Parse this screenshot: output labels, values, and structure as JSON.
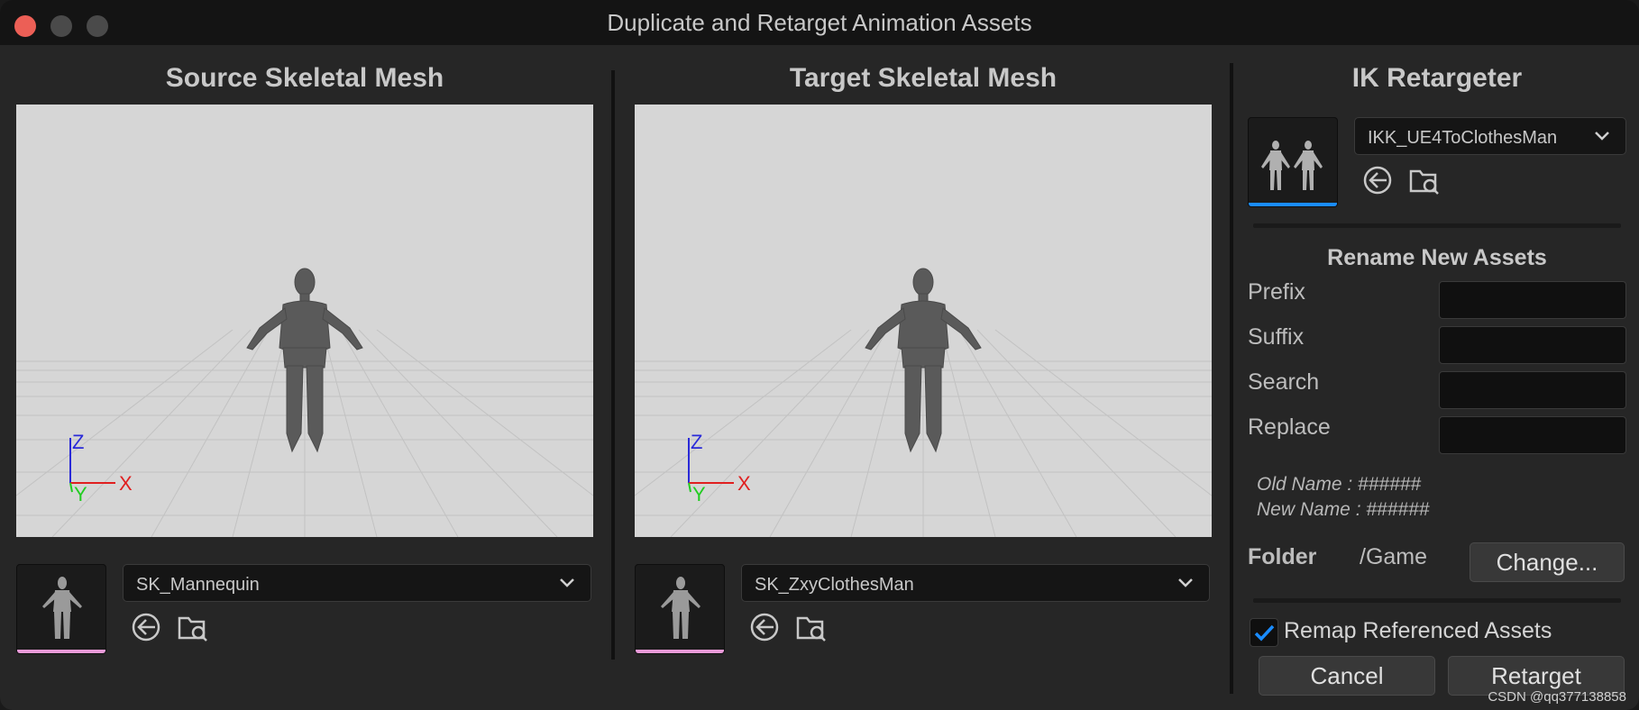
{
  "window": {
    "title": "Duplicate and Retarget Animation Assets"
  },
  "source": {
    "title": "Source Skeletal Mesh",
    "mesh": "SK_Mannequin",
    "bar_color": "#e89ad8"
  },
  "target": {
    "title": "Target Skeletal Mesh",
    "mesh": "SK_ZxyClothesMan",
    "bar_color": "#e89ad8"
  },
  "axes": {
    "z": "Z",
    "x": "X",
    "y": "Y",
    "z_color": "#2a2ad8",
    "x_color": "#e02020",
    "y_color": "#22cc22"
  },
  "retargeter": {
    "title": "IK Retargeter",
    "asset": "IKK_UE4ToClothesMan",
    "bar_color": "#1a8cff"
  },
  "rename": {
    "heading": "Rename New Assets",
    "prefix_label": "Prefix",
    "suffix_label": "Suffix",
    "search_label": "Search",
    "replace_label": "Replace",
    "prefix_value": "",
    "suffix_value": "",
    "search_value": "",
    "replace_value": "",
    "old_name": "Old Name : ######",
    "new_name": "New Name : ######"
  },
  "folder": {
    "label": "Folder",
    "path": "/Game",
    "change_label": "Change..."
  },
  "remap": {
    "label": "Remap Referenced Assets",
    "checked": true
  },
  "actions": {
    "cancel": "Cancel",
    "retarget": "Retarget"
  },
  "watermark": "CSDN @qq377138858",
  "icons": [
    "use-selected-icon",
    "browse-icon",
    "chevron-down-icon",
    "checkmark-icon"
  ]
}
